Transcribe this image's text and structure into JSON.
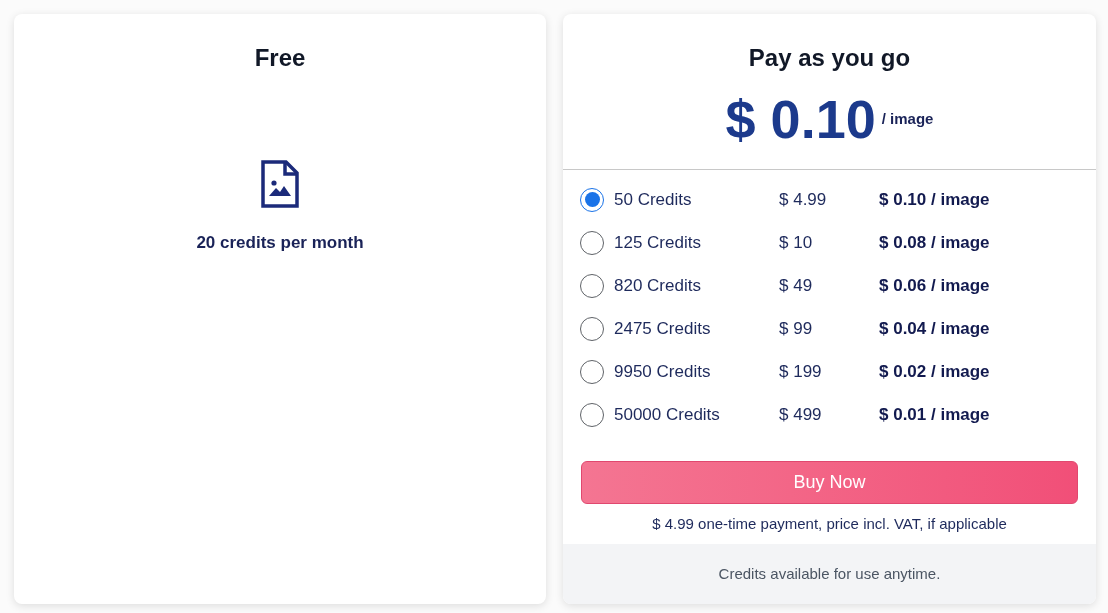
{
  "free_plan": {
    "title": "Free",
    "description": "20 credits per month"
  },
  "paid_plan": {
    "title": "Pay as you go",
    "price": "$ 0.10",
    "unit": "/ image",
    "options": [
      {
        "credits": "50 Credits",
        "price": "$ 4.99",
        "per_image": "$ 0.10 / image",
        "selected": true
      },
      {
        "credits": "125 Credits",
        "price": "$ 10",
        "per_image": "$ 0.08 / image",
        "selected": false
      },
      {
        "credits": "820 Credits",
        "price": "$ 49",
        "per_image": "$ 0.06 / image",
        "selected": false
      },
      {
        "credits": "2475 Credits",
        "price": "$ 99",
        "per_image": "$ 0.04 / image",
        "selected": false
      },
      {
        "credits": "9950 Credits",
        "price": "$ 199",
        "per_image": "$ 0.02 / image",
        "selected": false
      },
      {
        "credits": "50000 Credits",
        "price": "$ 499",
        "per_image": "$ 0.01 / image",
        "selected": false
      }
    ],
    "button": "Buy Now",
    "note": "$ 4.99 one-time payment, price incl. VAT, if applicable",
    "footer": "Credits available for use anytime."
  }
}
